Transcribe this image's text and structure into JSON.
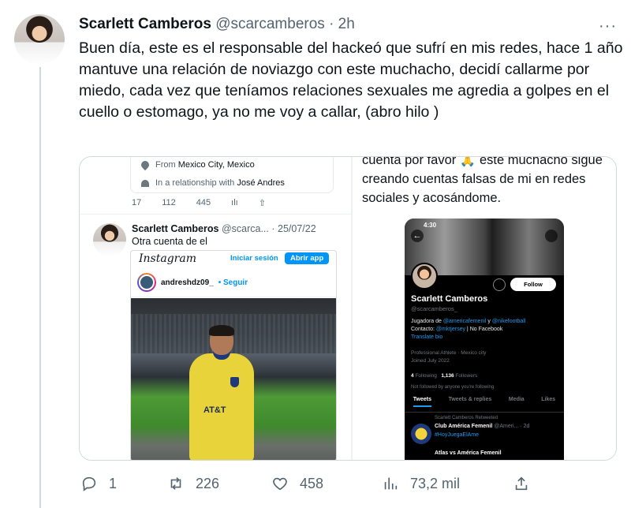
{
  "tweet": {
    "display_name": "Scarlett Camberos",
    "meta": "@scarcamberos · 2h",
    "more_label": "···",
    "text": "Buen día, este es el responsable del hackeó que sufrí en mis redes, hace 1 año mantuve una relación de noviazgo con este muchacho, decidí callarme por miedo, cada vez que teníamos relaciones sexuales me agredia a golpes en el cuello o estomago, ya no me voy a callar, (abro hilo )"
  },
  "left_screenshot": {
    "location_prefix": "From",
    "location": "Mexico City, Mexico",
    "relationship_prefix": "In a relationship with",
    "relationship_name": "José Andres",
    "counts": [
      "17",
      "112",
      "445",
      "ılı",
      "⇧"
    ],
    "quoted_name": "Scarlett Camberos",
    "quoted_meta": "@scarca... · 25/07/22",
    "quoted_text": "Otra cuenta de el",
    "instagram": {
      "logo": "Instagram",
      "login": "Iniciar sesión",
      "open_app": "Abrir app",
      "username": "andreshdz09_",
      "follow": "• Seguir",
      "shirt_text": "AT&T"
    }
  },
  "right_screenshot": {
    "caption": "cuenta por favor 🙏 este muchacho sigue creando cuentas falsas de mi en redes sociales y acosándome.",
    "phone": {
      "time": "4:30",
      "follow": "Follow",
      "name": "Scarlett Camberos",
      "handle": "@scarcamberos_",
      "bio_line1_prefix": "Jugadora de ",
      "bio_line1_link1": "@americafemenil",
      "bio_line1_mid": " y ",
      "bio_line1_link2": "@nikefootball",
      "bio_line2_prefix": "Contacto: ",
      "bio_line2_link": "@mktjersey",
      "bio_line2_suffix": " | No Facebook",
      "translate": "Translate bio",
      "meta1": "Professional Athlete · Mexico city",
      "meta2": "Joined July 2022",
      "following_count": "4",
      "following_label": "Following",
      "followers_count": "1,136",
      "followers_label": "Followers",
      "not_followed": "Not followed by anyone you're following",
      "tabs": [
        "Tweets",
        "Tweets & replies",
        "Media",
        "Likes"
      ],
      "retweeted": "Scarlett Camberos Retweeted",
      "rt_name": "Club América Femenil",
      "rt_meta": "@Ameri... · 2d",
      "rt_hashtag": "#HoyJuegaElAme",
      "rt_text": "Atlas vs América Femenil"
    }
  },
  "actions": {
    "replies": "1",
    "retweets": "226",
    "likes": "458",
    "views": "73,2 mil"
  }
}
